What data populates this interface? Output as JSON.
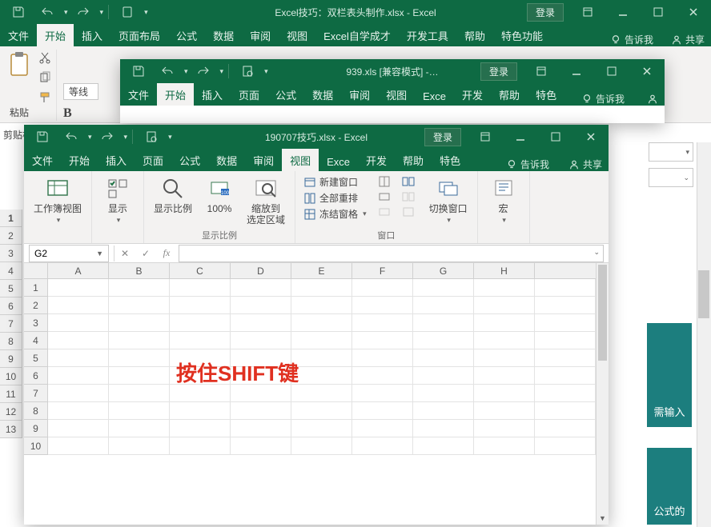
{
  "window1": {
    "title": "Excel技巧：双栏表头制作.xlsx - Excel",
    "login": "登录",
    "tabs": [
      "文件",
      "开始",
      "插入",
      "页面布局",
      "公式",
      "数据",
      "审阅",
      "视图",
      "Excel自学成才",
      "开发工具",
      "帮助",
      "特色功能"
    ],
    "active_tab": 1,
    "tell_me": "告诉我",
    "share": "共享",
    "font_name": "等线",
    "bold": "B",
    "clipboard_label": "剪贴板",
    "paste_label": "粘贴",
    "row_headers": [
      "1",
      "2",
      "3",
      "4",
      "5",
      "6",
      "7",
      "8",
      "9",
      "10",
      "11",
      "12",
      "13"
    ],
    "teal_top": "需输入",
    "teal_bottom": "公式的",
    "big1": "1"
  },
  "window2": {
    "title": "939.xls [兼容模式] -…",
    "login": "登录",
    "tabs": [
      "文件",
      "开始",
      "插入",
      "页面",
      "公式",
      "数据",
      "审阅",
      "视图",
      "Exce",
      "开发",
      "帮助",
      "特色"
    ],
    "active_tab": 1,
    "tell_me": "告诉我"
  },
  "window3": {
    "title": "190707技巧.xlsx - Excel",
    "login": "登录",
    "tabs": [
      "文件",
      "开始",
      "插入",
      "页面",
      "公式",
      "数据",
      "审阅",
      "视图",
      "Exce",
      "开发",
      "帮助",
      "特色"
    ],
    "active_tab": 7,
    "tell_me": "告诉我",
    "share": "共享",
    "ribbon": {
      "views_label": "",
      "workbook_views": "工作簿视图",
      "show": "显示",
      "zoom": "显示比例",
      "hundred": "100%",
      "zoom_sel": "缩放到\n选定区域",
      "zoom_group": "显示比例",
      "new_window": "新建窗口",
      "arrange": "全部重排",
      "freeze": "冻结窗格",
      "switch": "切换窗口",
      "window_group": "窗口",
      "macros": "宏"
    },
    "namebox": "G2",
    "fx_label": "fx",
    "columns": [
      "A",
      "B",
      "C",
      "D",
      "E",
      "F",
      "G",
      "H"
    ],
    "rows": [
      "1",
      "2",
      "3",
      "4",
      "5",
      "6",
      "7",
      "8",
      "9",
      "10"
    ],
    "overlay": "按住SHIFT键"
  }
}
